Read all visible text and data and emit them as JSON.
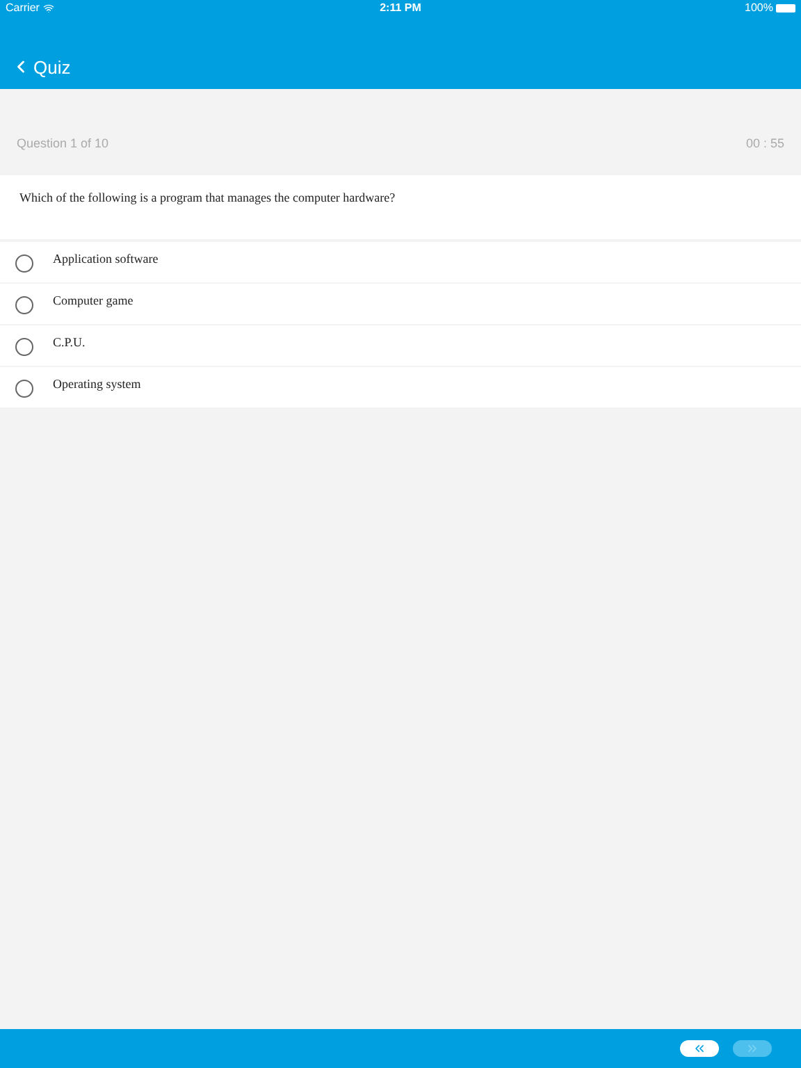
{
  "status_bar": {
    "carrier": "Carrier",
    "time": "2:11 PM",
    "battery": "100%"
  },
  "nav": {
    "title": "Quiz"
  },
  "progress": {
    "question": "Question 1 of 10",
    "timer": "00 : 55"
  },
  "question": "Which of the following is a program that manages the computer hardware?",
  "options": [
    {
      "label": "Application software",
      "selected": false
    },
    {
      "label": "Computer game",
      "selected": false
    },
    {
      "label": "C.P.U.",
      "selected": false
    },
    {
      "label": "Operating system",
      "selected": false
    }
  ],
  "footer": {
    "buttons": [
      {
        "kind": "previous",
        "disabled": false
      },
      {
        "kind": "next",
        "disabled": true
      }
    ]
  }
}
